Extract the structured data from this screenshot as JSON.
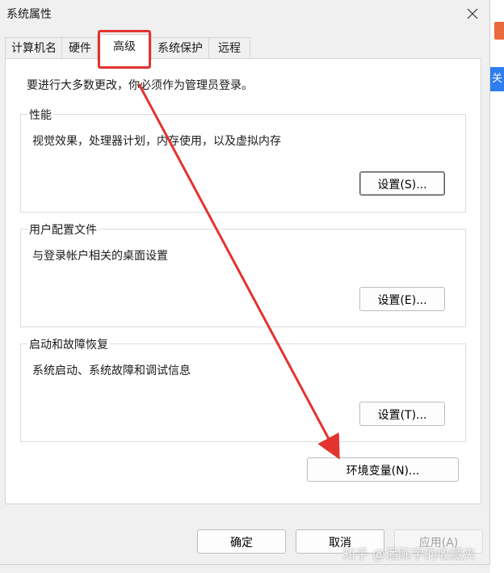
{
  "window": {
    "title": "系统属性"
  },
  "tabs": [
    {
      "label": "计算机名"
    },
    {
      "label": "硬件"
    },
    {
      "label": "高级"
    },
    {
      "label": "系统保护"
    },
    {
      "label": "远程"
    }
  ],
  "panel": {
    "notice": "要进行大多数更改，你必须作为管理员登录。",
    "performance": {
      "title": "性能",
      "desc": "视觉效果，处理器计划，内存使用，以及虚拟内存",
      "button": "设置(S)..."
    },
    "user_profiles": {
      "title": "用户配置文件",
      "desc": "与登录帐户相关的桌面设置",
      "button": "设置(E)..."
    },
    "startup_recovery": {
      "title": "启动和故障恢复",
      "desc": "系统启动、系统故障和调试信息",
      "button": "设置(T)..."
    },
    "env_button": "环境变量(N)..."
  },
  "footer": {
    "ok": "确定",
    "cancel": "取消",
    "apply": "应用(A)"
  },
  "side": {
    "label": "关"
  },
  "watermark": "知乎 @潘陈宇的收藏夹",
  "colors": {
    "annotation": "#e3332f",
    "accent": "#2f7ef0"
  }
}
